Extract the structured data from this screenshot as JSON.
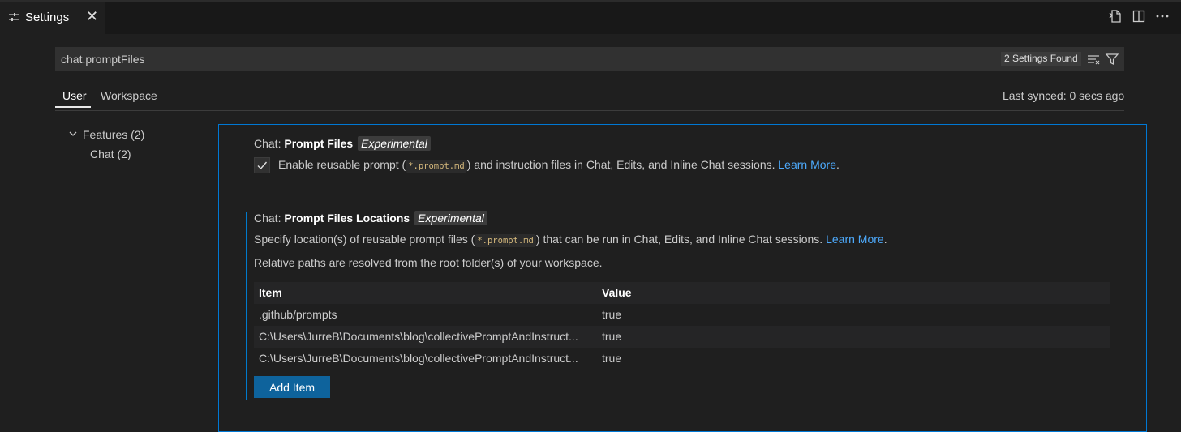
{
  "tab": {
    "title": "Settings",
    "close_icon": "close-icon",
    "icon": "settings-sliders-icon"
  },
  "editor_actions": {
    "open_json_icon": "open-settings-json-icon",
    "split_icon": "split-editor-icon",
    "more_icon": "more-actions-icon"
  },
  "search": {
    "value": "chat.promptFiles",
    "results": "2 Settings Found",
    "clear_icon": "clear-filter-icon",
    "filter_icon": "filter-icon"
  },
  "scopes": {
    "user": "User",
    "workspace": "Workspace"
  },
  "sync": "Last synced: 0 secs ago",
  "toc": {
    "features": "Features (2)",
    "chat": "Chat (2)"
  },
  "setting1": {
    "category": "Chat: ",
    "name": "Prompt Files",
    "badge": "Experimental",
    "checked": true,
    "desc_pre": "Enable reusable prompt (",
    "code": "*.prompt.md",
    "desc_post": ") and instruction files in Chat, Edits, and Inline Chat sessions. ",
    "link": "Learn More",
    "end": "."
  },
  "setting2": {
    "category": "Chat: ",
    "name": "Prompt Files Locations",
    "badge": "Experimental",
    "desc_pre": "Specify location(s) of reusable prompt files (",
    "code": "*.prompt.md",
    "desc_post": ") that can be run in Chat, Edits, and Inline Chat sessions. ",
    "link": "Learn More",
    "end": ".",
    "desc2": "Relative paths are resolved from the root folder(s) of your workspace.",
    "table": {
      "headers": [
        "Item",
        "Value"
      ],
      "rows": [
        {
          "item": ".github/prompts",
          "value": "true"
        },
        {
          "item": "C:\\Users\\JurreB\\Documents\\blog\\collectivePromptAndInstruct...",
          "value": "true"
        },
        {
          "item": "C:\\Users\\JurreB\\Documents\\blog\\collectivePromptAndInstruct...",
          "value": "true"
        }
      ]
    },
    "add_button": "Add Item"
  },
  "colors": {
    "accent": "#0078d4",
    "link": "#4daafc",
    "button": "#0e639c"
  }
}
